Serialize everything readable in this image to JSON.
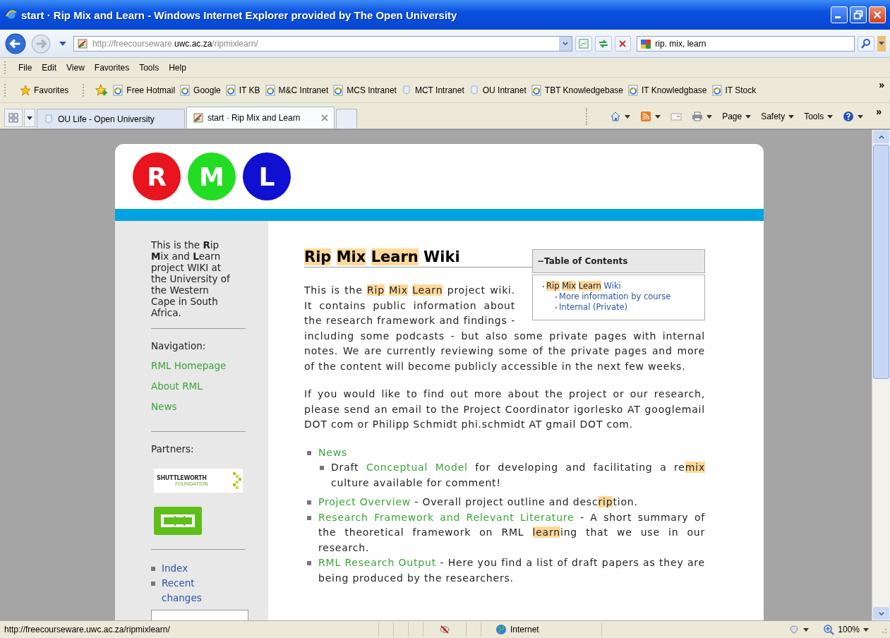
{
  "window": {
    "title": "start · Rip Mix and Learn - Windows Internet Explorer provided by The Open University"
  },
  "address_bar": {
    "url": [
      {
        "text": "http://freecourseware.",
        "kind": "dim"
      },
      {
        "text": "uwc.ac.za",
        "kind": "host"
      },
      {
        "text": "/ripmixlearn/",
        "kind": "dim"
      }
    ]
  },
  "search_box": {
    "value": "rip. mix, learn"
  },
  "menu": [
    "File",
    "Edit",
    "View",
    "Favorites",
    "Tools",
    "Help"
  ],
  "favorites_bar": {
    "favorites_button": "Favorites",
    "links": [
      {
        "label": "Free Hotmail",
        "kind": "ie"
      },
      {
        "label": "Google",
        "kind": "ie"
      },
      {
        "label": "IT KB",
        "kind": "ie"
      },
      {
        "label": "M&C Intranet",
        "kind": "ie"
      },
      {
        "label": "MCS Intranet",
        "kind": "ie"
      },
      {
        "label": "MCT Intranet",
        "kind": "globe"
      },
      {
        "label": "OU Intranet",
        "kind": "globe"
      },
      {
        "label": "TBT Knowledgebase",
        "kind": "ie"
      },
      {
        "label": "IT Knowledgbase",
        "kind": "ie"
      },
      {
        "label": "IT Stock",
        "kind": "ie"
      }
    ],
    "overflow": "»"
  },
  "tabs": [
    {
      "label": "OU Life - Open University",
      "selected": false,
      "kind": "globe"
    },
    {
      "label": "start · Rip Mix and Learn",
      "selected": true,
      "kind": "page"
    }
  ],
  "command_bar": {
    "menus": [
      "Page",
      "Safety",
      "Tools"
    ],
    "overflow": "»"
  },
  "page": {
    "logo": [
      {
        "letter": "R",
        "color": "#e8141e"
      },
      {
        "letter": "M",
        "color": "#22dd22"
      },
      {
        "letter": "L",
        "color": "#1010d0"
      }
    ],
    "sidebar": {
      "intro": "This is the **R**ip **M**ix and **L**earn project WIKI at the University of the Western Cape in South Africa.",
      "navigation_heading": "Navigation:",
      "nav_links": [
        "RML Homepage",
        "About RML",
        "News"
      ],
      "partners_heading": "Partners:",
      "partner_logo_text": [
        "SHUTTLEWORTH",
        "FOUNDATION"
      ],
      "tool_links": [
        "Index",
        "Recent changes"
      ]
    },
    "heading": [
      {
        "text": "Rip",
        "kind": "hit"
      },
      {
        "text": "Mix",
        "kind": "hit"
      },
      {
        "text": "Learn",
        "kind": "hit"
      },
      {
        "text": " Wiki",
        "kind": "plain"
      }
    ],
    "toc": {
      "toggle": "−",
      "title": "Table of Contents",
      "items": [
        {
          "segments": [
            {
              "text": "Rip",
              "kind": "hit"
            },
            {
              "text": "Mix",
              "kind": "hit"
            },
            {
              "text": "Learn",
              "kind": "hit"
            },
            {
              "text": "Wiki",
              "kind": "link"
            }
          ],
          "children": [
            {
              "label": "More information by course"
            },
            {
              "label": "Internal (Private)"
            }
          ]
        }
      ]
    },
    "paragraphs": [
      [
        {
          "text": "This is the ",
          "kind": "plain"
        },
        {
          "text": "Rip",
          "kind": "hit"
        },
        {
          "text": "Mix",
          "kind": "hit"
        },
        {
          "text": "Learn",
          "kind": "hit"
        },
        {
          "text": " project wiki. It contains public information about the research framework and findings - including some podcasts - but also some private pages with internal notes. We are currently reviewing some of the private pages and more of the content will become publicly accessible in the next few weeks.",
          "kind": "plain"
        }
      ],
      [
        {
          "text": "If you would like to find out more about the project or our research, please send an email to the Project Coordinator igorlesko AT googlemail DOT com or Philipp Schmidt phi.schmidt AT gmail DOT com.",
          "kind": "plain"
        }
      ]
    ],
    "list": [
      {
        "segments": [
          {
            "text": "News",
            "kind": "link"
          }
        ],
        "children": [
          {
            "segments": [
              {
                "text": "Draft ",
                "kind": "plain"
              },
              {
                "text": "Conceptual Model",
                "kind": "link"
              },
              {
                "text": " for developing and facilitating a re",
                "kind": "plain"
              },
              {
                "text": "mix",
                "kind": "hit"
              },
              {
                "text": " culture available for comment!",
                "kind": "plain"
              }
            ]
          }
        ]
      },
      {
        "segments": [
          {
            "text": "Project Overview",
            "kind": "link"
          },
          {
            "text": " - Overall project outline and desc",
            "kind": "plain"
          },
          {
            "text": "rip",
            "kind": "hit"
          },
          {
            "text": "tion.",
            "kind": "plain"
          }
        ]
      },
      {
        "segments": [
          {
            "text": "Research Framework and Relevant Literature",
            "kind": "link"
          },
          {
            "text": " - A short summary of the theoretical framework on RML ",
            "kind": "plain"
          },
          {
            "text": "learn",
            "kind": "hit"
          },
          {
            "text": "ing that we use in our research.",
            "kind": "plain"
          }
        ]
      },
      {
        "segments": [
          {
            "text": "RML Research Output",
            "kind": "link"
          },
          {
            "text": " - Here you find a list of draft papers as they are being produced by the researchers.",
            "kind": "plain"
          }
        ]
      }
    ]
  },
  "status_bar": {
    "url": "http://freecourseware.uwc.ac.za/ripmixlearn/",
    "zone": "Internet",
    "zoom": "100%"
  }
}
